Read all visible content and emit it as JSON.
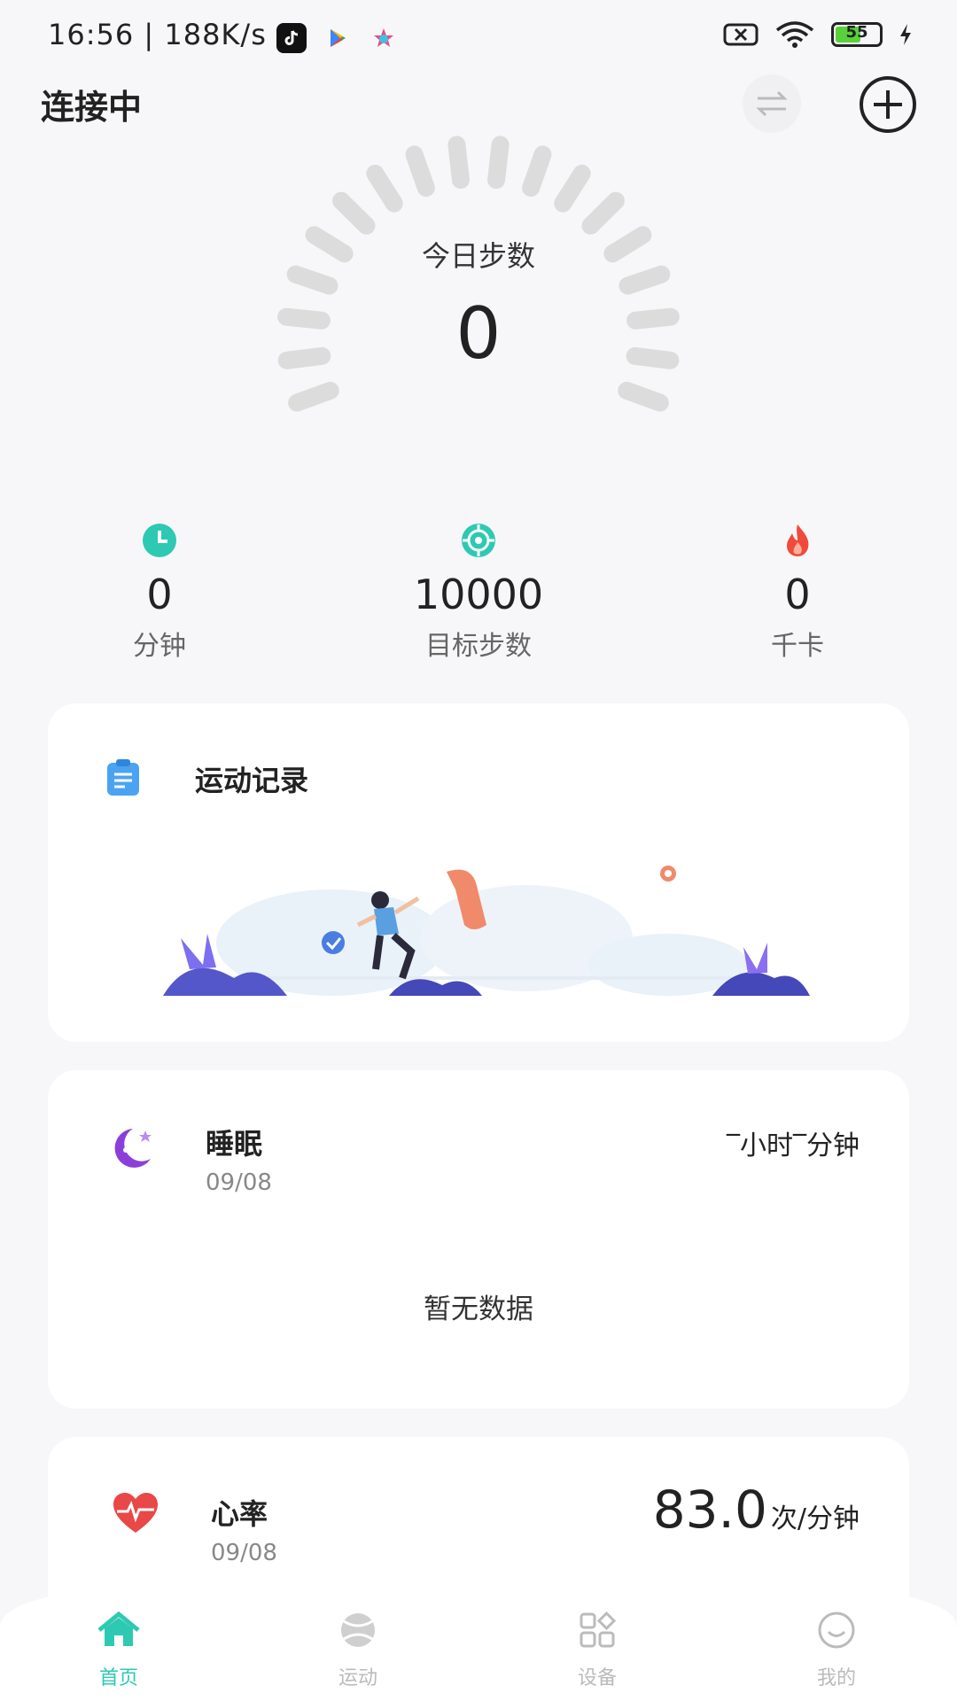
{
  "status_bar": {
    "time": "16:56",
    "speed": "188K/s",
    "battery": "55"
  },
  "header": {
    "title": "连接中"
  },
  "steps": {
    "label": "今日步数",
    "value": "0"
  },
  "stats": [
    {
      "icon": "clock-icon",
      "value": "0",
      "label": "分钟"
    },
    {
      "icon": "target-icon",
      "value": "10000",
      "label": "目标步数"
    },
    {
      "icon": "flame-icon",
      "value": "0",
      "label": "千卡"
    }
  ],
  "cards": {
    "exercise": {
      "title": "运动记录"
    },
    "sleep": {
      "title": "睡眠",
      "date": "09/08",
      "summary": "‾小时‾分钟",
      "empty": "暂无数据"
    },
    "heart": {
      "title": "心率",
      "date": "09/08",
      "value": "83.0",
      "unit": "次/分钟"
    }
  },
  "tabs": [
    {
      "label": "首页",
      "icon": "home-icon",
      "active": true
    },
    {
      "label": "运动",
      "icon": "ball-icon",
      "active": false
    },
    {
      "label": "设备",
      "icon": "grid-icon",
      "active": false
    },
    {
      "label": "我的",
      "icon": "smile-icon",
      "active": false
    }
  ],
  "colors": {
    "accent": "#2ec9b3",
    "heart": "#e84848",
    "sleep": "#8b3fd8",
    "flame": "#f04a3a"
  }
}
